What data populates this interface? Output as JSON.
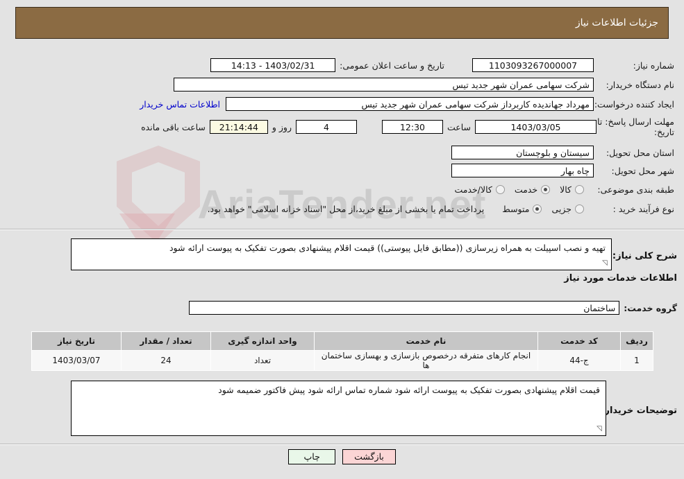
{
  "header": {
    "title": "جزئیات اطلاعات نیاز"
  },
  "watermark": {
    "text": "AriaTender.net"
  },
  "info": {
    "need_number_label": "شماره نیاز:",
    "need_number_value": "1103093267000007",
    "announce_datetime_label": "تاریخ و ساعت اعلان عمومی:",
    "announce_datetime_value": "1403/02/31 - 14:13",
    "buyer_org_label": "نام دستگاه خریدار:",
    "buyer_org_value": "شرکت سهامی عمران شهر جدید تیس",
    "requester_label": "ایجاد کننده درخواست:",
    "requester_value": "مهرداد جهاندیده کاربرداز شرکت سهامی عمران شهر جدید تیس",
    "buyer_contact_link": "اطلاعات تماس خریدار",
    "deadline_label": "مهلت ارسال پاسخ: تا تاریخ:",
    "deadline_date_value": "1403/03/05",
    "hour_label": "ساعت",
    "deadline_time_value": "12:30",
    "days_value": "4",
    "days_label": "روز و",
    "countdown_value": "21:14:44",
    "remaining_label": "ساعت باقی مانده",
    "province_label": "استان محل تحویل:",
    "province_value": "سیستان و بلوچستان",
    "city_label": "شهر محل تحویل:",
    "city_value": "چاه بهار",
    "category_label": "طبقه بندی موضوعی:",
    "category_options": [
      {
        "label": "کالا",
        "selected": false
      },
      {
        "label": "خدمت",
        "selected": true
      },
      {
        "label": "کالا/خدمت",
        "selected": false
      }
    ],
    "purchase_type_label": "نوع فرآیند خرید :",
    "purchase_type_options": [
      {
        "label": "جزیی",
        "selected": false
      },
      {
        "label": "متوسط",
        "selected": true
      }
    ],
    "payment_note": "پرداخت تمام یا بخشی از مبلغ خرید،از محل \"اسناد خزانه اسلامی\" خواهد بود."
  },
  "general_description": {
    "label": "شرح کلی نیاز:",
    "value": "تهیه و نصب اسپیلت به همراه زیرسازی ((مطابق فایل پیوستی))\nقیمت اقلام پیشنهادی بصورت تفکیک به پیوست ارائه شود"
  },
  "services_section": {
    "heading": "اطلاعات خدمات مورد نیاز",
    "service_group_label": "گروه خدمت:",
    "service_group_value": "ساختمان"
  },
  "table": {
    "headers": [
      "ردیف",
      "کد خدمت",
      "نام خدمت",
      "واحد اندازه گیری",
      "تعداد / مقدار",
      "تاریخ نیاز"
    ],
    "rows": [
      {
        "row_no": "1",
        "service_code": "ج-44",
        "service_name": "انجام کارهای متفرقه درخصوص بازسازی و بهسازی ساختمان ها",
        "unit": "تعداد",
        "quantity": "24",
        "need_date": "1403/03/07"
      }
    ]
  },
  "buyer_notes": {
    "label": "توضیحات خریدار:",
    "value": "قیمت اقلام پیشنهادی بصورت تفکیک به پیوست ارائه شود\nشماره تماس ارائه شود\nپیش فاکتور ضمیمه شود"
  },
  "buttons": {
    "print": "چاپ",
    "back": "بازگشت"
  },
  "colors": {
    "header_bg": "#8b6b43",
    "page_bg": "#e3e3e3",
    "link": "#0000cc",
    "table_header_bg": "#c6c6c6",
    "print_btn_bg": "#e9f7e9",
    "back_btn_bg": "#fbd5d5",
    "countdown_bg": "#fcfbe3"
  }
}
